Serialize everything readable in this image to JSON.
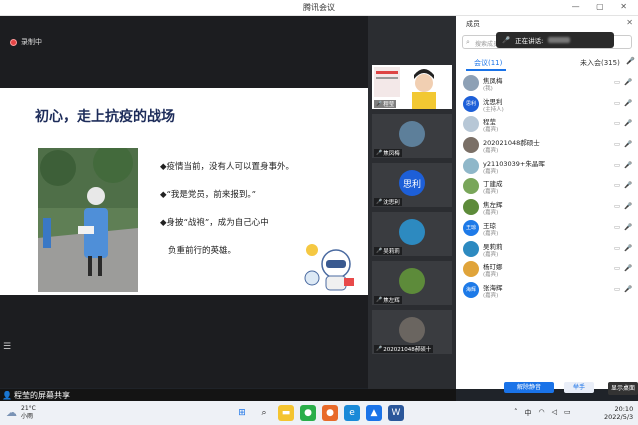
{
  "window": {
    "title": "腾讯会议",
    "controls": "— ▢ ✕"
  },
  "recording": {
    "label": "录制中"
  },
  "slide": {
    "title": "初心，走上抗疫的战场",
    "bullets": [
      "◆疫情当前，没有人可以置身事外。",
      "◆“我是党员，前来报到。”",
      "◆身披“战袍”，成为自己心中",
      "负重前行的英雄。"
    ]
  },
  "screen_share": {
    "label": "程莹的屏幕共享"
  },
  "thumbnails": [
    {
      "name": "程莹",
      "color": "#d7dde6"
    },
    {
      "name": "焦凤梅",
      "color": "#5d7f9a"
    },
    {
      "name": "沈思利",
      "avatar_text": "思利",
      "color": "#1d5fd8"
    },
    {
      "name": "吴莉莉",
      "color": "#2d8ac0"
    },
    {
      "name": "焦左辉",
      "color": "#5d8b3a"
    },
    {
      "name": "202021048郝硕十",
      "color": "#6a6560"
    }
  ],
  "panel": {
    "title": "成员",
    "close": "✕",
    "search_placeholder": "搜索成员",
    "speaking_toast": "正在讲话:",
    "tabs": {
      "in_meeting": "会议(11)",
      "not_joined": "未入会(315)"
    },
    "members": [
      {
        "name": "焦凤梅",
        "role": "(我)",
        "avatar_color": "#8da0b5",
        "mic_red": false
      },
      {
        "name": "沈思利",
        "role": "(主持人)",
        "avatar_text": "思利",
        "avatar_color": "#1d5fd8",
        "mic_red": true
      },
      {
        "name": "程莹",
        "role": "(嘉宾)",
        "avatar_color": "#b7c7d6",
        "mic_red": false
      },
      {
        "name": "202021048郝硕士",
        "role": "(嘉宾)",
        "avatar_color": "#7a6f66",
        "mic_red": true
      },
      {
        "name": "y21103039+朱晶晖",
        "role": "(嘉宾)",
        "avatar_color": "#8fb7c9",
        "mic_red": true
      },
      {
        "name": "丁建成",
        "role": "(嘉宾)",
        "avatar_color": "#79a65a",
        "mic_red": true
      },
      {
        "name": "焦左辉",
        "role": "(嘉宾)",
        "avatar_color": "#5d8b3a",
        "mic_red": true
      },
      {
        "name": "王琼",
        "role": "(嘉宾)",
        "avatar_text": "王琼",
        "avatar_color": "#1d7ae8",
        "mic_red": true
      },
      {
        "name": "吴莉莉",
        "role": "(嘉宾)",
        "avatar_color": "#2d8ac0",
        "mic_red": true
      },
      {
        "name": "杨玎娜",
        "role": "(嘉宾)",
        "avatar_color": "#e0a43a",
        "mic_red": true
      },
      {
        "name": "张海辉",
        "role": "(嘉宾)",
        "avatar_text": "海辉",
        "avatar_color": "#1d7ae8",
        "mic_red": true
      }
    ],
    "unmute_all": "解除静音",
    "raise_hand": "举手"
  },
  "show_desktop": "显示桌面",
  "taskbar": {
    "weather_temp": "21°C",
    "weather_desc": "小雨",
    "time": "20:10",
    "date": "2022/5/3",
    "ime": "中"
  }
}
